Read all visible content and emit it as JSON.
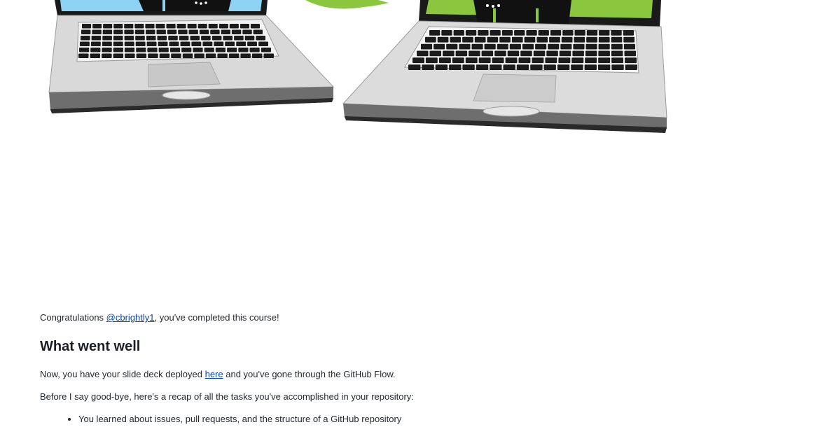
{
  "congrats": {
    "prefix": "Congratulations ",
    "user_link": "@cbrightly1",
    "suffix": ", you've completed this course!"
  },
  "heading": "What went well",
  "deployed": {
    "prefix": "Now, you have your slide deck deployed ",
    "link": "here",
    "suffix": " and you've gone through the GitHub Flow."
  },
  "recap_intro": "Before I say good-bye, here's a recap of all the tasks you've accomplished in your repository:",
  "tasks": [
    "You learned about issues, pull requests, and the structure of a GitHub repository"
  ],
  "colors": {
    "link": "#0645ad",
    "screen_left": "#8fd3f4",
    "screen_right": "#8cc63f",
    "speech_bubble": "#8cc63f"
  }
}
